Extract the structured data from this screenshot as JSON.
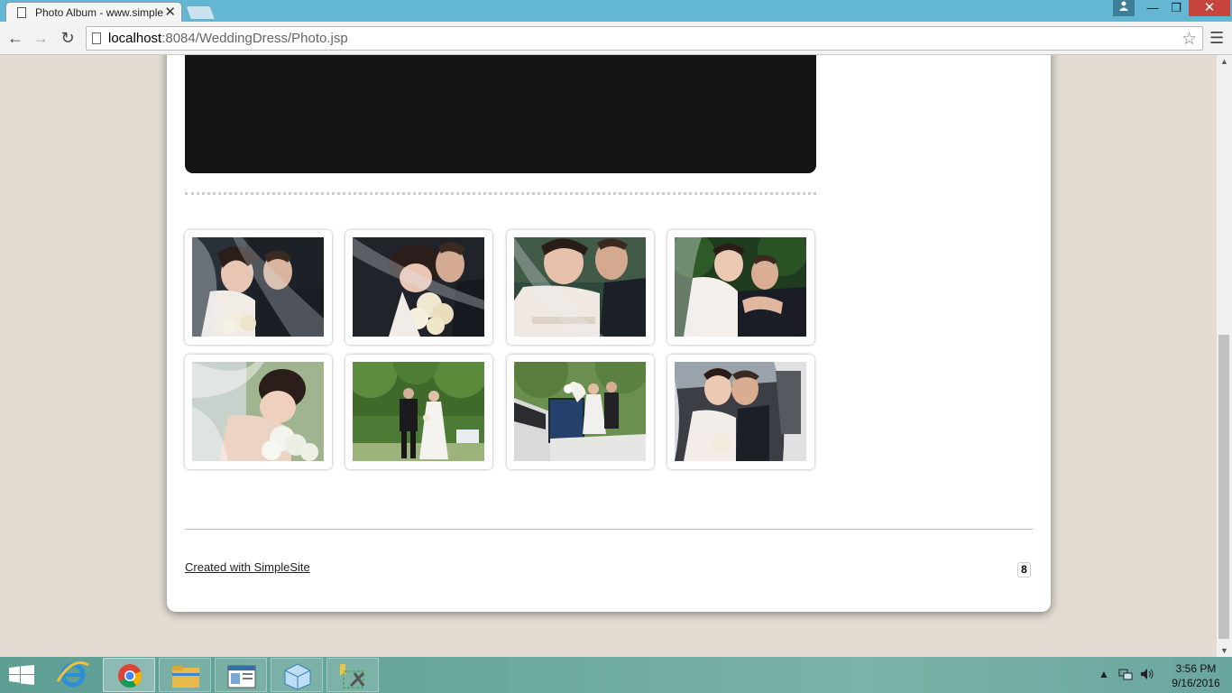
{
  "browser": {
    "tab_title": "Photo Album - www.simplesite.com",
    "tab_close": "✕",
    "url_host": "localhost",
    "url_rest": ":8084/WeddingDress/Photo.jsp"
  },
  "gallery": {
    "photos": [
      {
        "scene": "bride veiled with groom, bouquet"
      },
      {
        "scene": "close-up kiss under veil, bouquet"
      },
      {
        "scene": "smiling bride under veil with groom"
      },
      {
        "scene": "bride and groom embracing"
      },
      {
        "scene": "bride smelling bouquet"
      },
      {
        "scene": "couple walking in park"
      },
      {
        "scene": "couple by white car door"
      },
      {
        "scene": "couple smiling inside car"
      }
    ]
  },
  "footer": {
    "link_text": "Created with SimpleSite",
    "badge": "8"
  },
  "taskbar": {
    "apps": [
      "internet-explorer",
      "chrome",
      "file-explorer",
      "window-app",
      "box-app",
      "tools-app"
    ],
    "time": "3:56 PM",
    "date": "9/16/2016"
  }
}
